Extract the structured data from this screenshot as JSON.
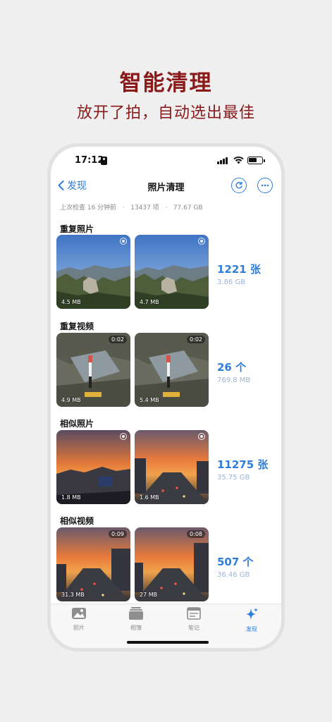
{
  "promo": {
    "title": "智能清理",
    "subtitle": "放开了拍，自动选出最佳"
  },
  "status_bar": {
    "time": "17:12"
  },
  "nav": {
    "back_label": "发现",
    "title": "照片清理"
  },
  "meta": {
    "last_check": "上次检查 16 分钟前",
    "items": "13437 项",
    "size": "77.67 GB",
    "separator": "·"
  },
  "sections": [
    {
      "title": "重复照片",
      "count": "1221 张",
      "bytes": "3.86 GB",
      "thumbs": [
        {
          "size": "4.5 MB",
          "scene": "mountain"
        },
        {
          "size": "4.7 MB",
          "scene": "mountain"
        }
      ]
    },
    {
      "title": "重复视频",
      "count": "26 个",
      "bytes": "769.8 MB",
      "thumbs": [
        {
          "size": "4.9 MB",
          "duration": "0:02",
          "scene": "rock"
        },
        {
          "size": "5.4 MB",
          "duration": "0:02",
          "scene": "rock"
        }
      ]
    },
    {
      "title": "相似照片",
      "count": "11275 张",
      "bytes": "35.75 GB",
      "thumbs": [
        {
          "size": "1.8 MB",
          "scene": "sunset"
        },
        {
          "size": "1.6 MB",
          "scene": "sunset-road"
        }
      ]
    },
    {
      "title": "相似视频",
      "count": "507 个",
      "bytes": "36.46 GB",
      "thumbs": [
        {
          "size": "31.3 MB",
          "duration": "0:09",
          "scene": "sunset-road"
        },
        {
          "size": "27 MB",
          "duration": "0:08",
          "scene": "sunset-road"
        }
      ]
    }
  ],
  "tabs": [
    {
      "label": "照片",
      "icon": "photos-icon",
      "active": false
    },
    {
      "label": "相簿",
      "icon": "albums-icon",
      "active": false
    },
    {
      "label": "笔记",
      "icon": "notes-icon",
      "active": false
    },
    {
      "label": "发现",
      "icon": "sparkle-icon",
      "active": true
    }
  ],
  "colors": {
    "accent": "#2f7ddb",
    "promo": "#8a1a1a",
    "background": "#efefef"
  }
}
